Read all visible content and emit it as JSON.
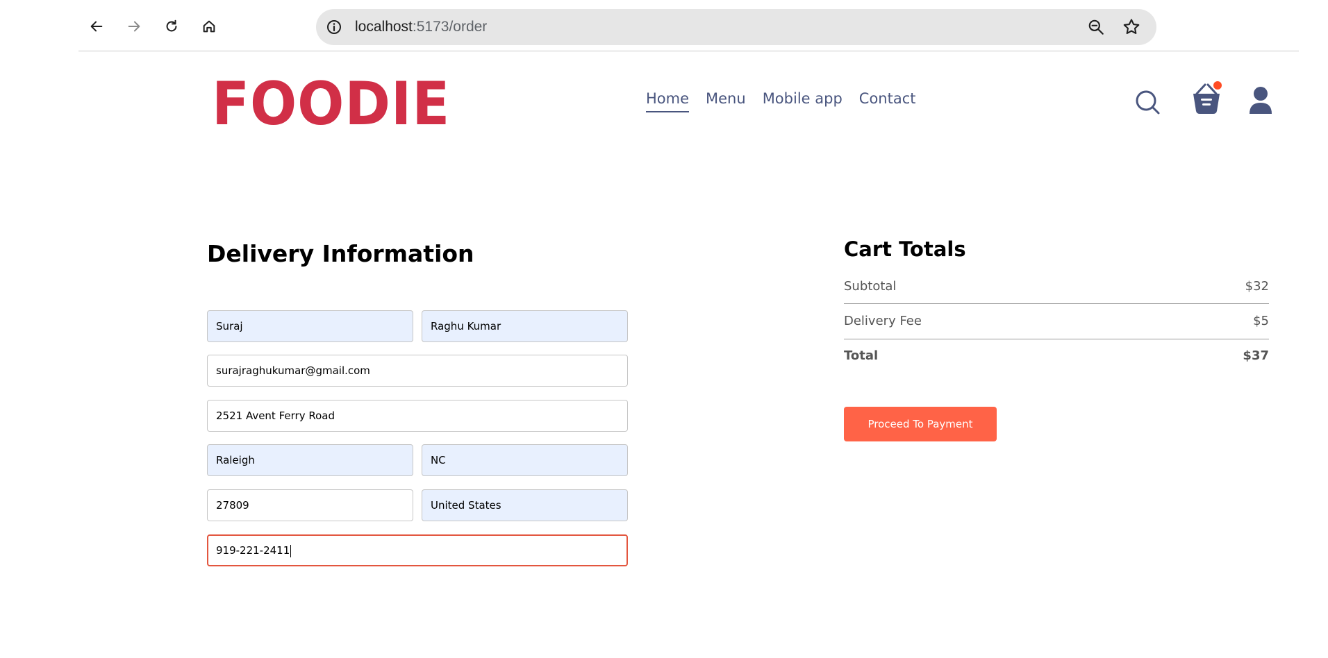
{
  "browser": {
    "url_host": "localhost",
    "url_path": ":5173/order",
    "icons": [
      "back-icon",
      "forward-icon",
      "reload-icon",
      "home-icon",
      "site-info-icon",
      "zoom-out-icon",
      "bookmark-star-icon"
    ]
  },
  "header": {
    "logo": "FOODIE",
    "nav": [
      "Home",
      "Menu",
      "Mobile app",
      "Contact"
    ],
    "active_nav": "Home",
    "icons": [
      "search-icon",
      "basket-icon",
      "user-icon"
    ],
    "cart_dot_color": "#ff4c24"
  },
  "delivery": {
    "title": "Delivery Information",
    "first_name": "Suraj",
    "last_name": "Raghu Kumar",
    "email": "surajraghukumar@gmail.com",
    "street": "2521 Avent Ferry Road",
    "city": "Raleigh",
    "state": "NC",
    "zip": "27809",
    "country": "United States",
    "phone": "919-221-2411"
  },
  "cart": {
    "title": "Cart Totals",
    "subtotal_label": "Subtotal",
    "subtotal_value": "$32",
    "delivery_label": "Delivery Fee",
    "delivery_value": "$5",
    "total_label": "Total",
    "total_value": "$37",
    "button": "Proceed To Payment"
  },
  "colors": {
    "brand": "#d12f47",
    "accent": "#ff6347",
    "nav_text": "#49557e",
    "autofill_bg": "#e8f0fe"
  }
}
